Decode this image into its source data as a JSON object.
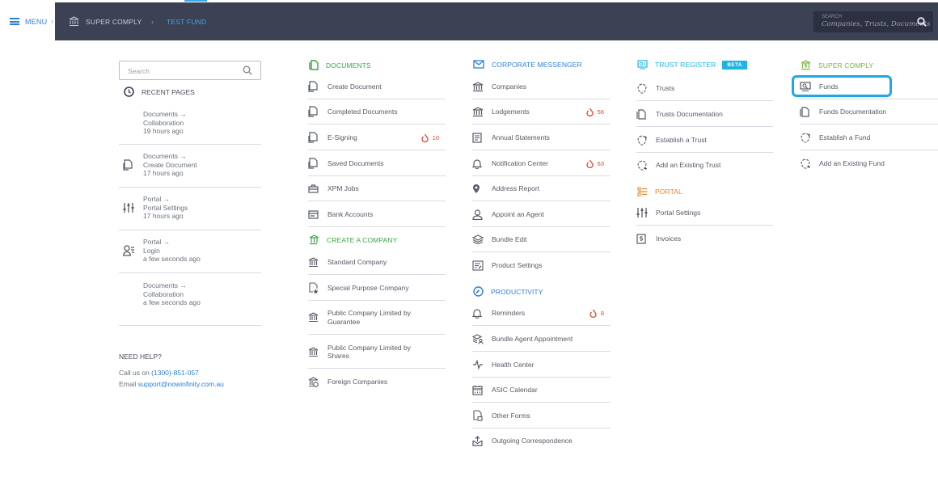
{
  "topbar": {
    "menu_label": "MENU",
    "breadcrumb_home": "SUPER COMPLY",
    "breadcrumb_sep": "›",
    "breadcrumb_current": "TEST FUND",
    "search_tiny": "SEARCH",
    "search_placeholder": "Companies, Trusts, Documents"
  },
  "left": {
    "search_placeholder": "Search",
    "recent_title": "RECENT PAGES",
    "recent": [
      {
        "line1": "Documents →",
        "line2": "Collaboration",
        "time": "19 hours ago",
        "icon": "none"
      },
      {
        "line1": "Documents →",
        "line2": "Create Document",
        "time": "17 hours ago",
        "icon": "document-icon"
      },
      {
        "line1": "Portal →",
        "line2": "Portal Settings",
        "time": "17 hours ago",
        "icon": "sliders-icon"
      },
      {
        "line1": "Portal →",
        "line2": "Login",
        "time": "a few seconds ago",
        "icon": "user-login-icon"
      },
      {
        "line1": "Documents →",
        "line2": "Collaboration",
        "time": "a few seconds ago",
        "icon": "none"
      }
    ],
    "help_title": "NEED HELP?",
    "call_label": "Call us on ",
    "phone": "(1300)-851-057",
    "email_label": "Email ",
    "email": "support@nowinfinity.com.au"
  },
  "documents": {
    "title": "DOCUMENTS",
    "items": [
      {
        "label": "Create Document"
      },
      {
        "label": "Completed Documents"
      },
      {
        "label": "E-Signing",
        "badge": "10"
      },
      {
        "label": "Saved Documents"
      },
      {
        "label": "XPM Jobs"
      },
      {
        "label": "Bank Accounts"
      }
    ]
  },
  "create_company": {
    "title": "CREATE A COMPANY",
    "items": [
      {
        "label": "Standard Company"
      },
      {
        "label": "Special Purpose Company"
      },
      {
        "label": "Public Company Limited by Guarantee"
      },
      {
        "label": "Public Company Limited by Shares"
      },
      {
        "label": "Foreign Companies"
      }
    ]
  },
  "corporate": {
    "title": "CORPORATE MESSENGER",
    "items": [
      {
        "label": "Companies"
      },
      {
        "label": "Lodgements",
        "badge": "56"
      },
      {
        "label": "Annual Statements"
      },
      {
        "label": "Notification Center",
        "badge": "63"
      },
      {
        "label": "Address Report"
      },
      {
        "label": "Appoint an Agent"
      },
      {
        "label": "Bundle Edit"
      },
      {
        "label": "Product Settings"
      }
    ]
  },
  "productivity": {
    "title": "PRODUCTIVITY",
    "items": [
      {
        "label": "Reminders",
        "badge": "8"
      },
      {
        "label": "Bundle Agent Appointment"
      },
      {
        "label": "Health Center"
      },
      {
        "label": "ASIC Calendar"
      },
      {
        "label": "Other Forms"
      },
      {
        "label": "Outgoing Correspondence"
      }
    ]
  },
  "trust": {
    "title": "TRUST REGISTER",
    "beta": "BETA",
    "items": [
      {
        "label": "Trusts"
      },
      {
        "label": "Trusts Documentation"
      },
      {
        "label": "Establish a Trust"
      },
      {
        "label": "Add an Existing Trust"
      }
    ]
  },
  "portal": {
    "title": "PORTAL",
    "items": [
      {
        "label": "Portal Settings"
      },
      {
        "label": "Invoices"
      }
    ]
  },
  "super": {
    "title": "SUPER COMPLY",
    "items": [
      {
        "label": "Funds"
      },
      {
        "label": "Funds Documentation"
      },
      {
        "label": "Establish a Fund"
      },
      {
        "label": "Add an Existing Fund"
      }
    ]
  }
}
